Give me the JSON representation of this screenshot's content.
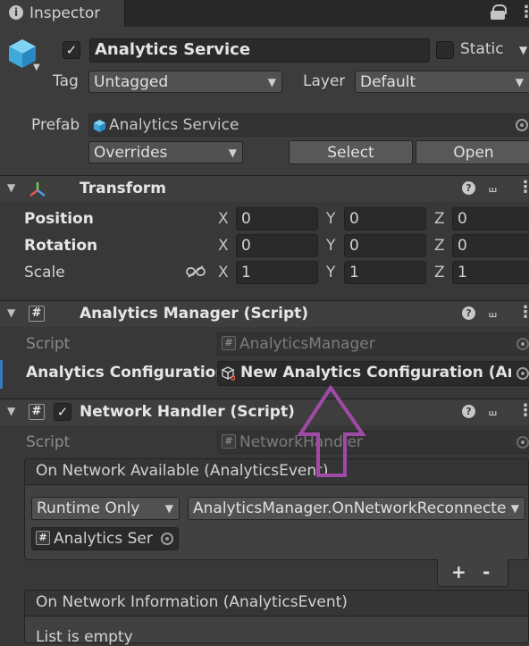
{
  "tab": {
    "title": "Inspector"
  },
  "object": {
    "name": "Analytics Service",
    "static_label": "Static",
    "tag_label": "Tag",
    "tag_value": "Untagged",
    "layer_label": "Layer",
    "layer_value": "Default",
    "prefab_label": "Prefab",
    "prefab_value": "Analytics Service",
    "overrides_label": "Overrides",
    "select_label": "Select",
    "open_label": "Open"
  },
  "transform": {
    "title": "Transform",
    "rows": [
      {
        "label": "Position",
        "x": "0",
        "y": "0",
        "z": "0"
      },
      {
        "label": "Rotation",
        "x": "0",
        "y": "0",
        "z": "0"
      },
      {
        "label": "Scale",
        "x": "1",
        "y": "1",
        "z": "1"
      }
    ],
    "axis": {
      "x": "X",
      "y": "Y",
      "z": "Z"
    }
  },
  "analytics_manager": {
    "title": "Analytics Manager (Script)",
    "script_label": "Script",
    "script_value": "AnalyticsManager",
    "config_label": "Analytics Configuration",
    "config_value": "New Analytics Configuration (Analy"
  },
  "network_handler": {
    "title": "Network Handler (Script)",
    "script_label": "Script",
    "script_value": "NetworkHandler",
    "event1_title": "On Network Available (AnalyticsEvent)",
    "runtime_value": "Runtime Only",
    "method_value": "AnalyticsManager.OnNetworkReconnecte",
    "target_value": "Analytics Ser",
    "add_label": "+",
    "remove_label": "-",
    "event2_title": "On Network Information (AnalyticsEvent)",
    "list_empty": "List is empty"
  },
  "annotation": {
    "color": "#a04aa8"
  }
}
